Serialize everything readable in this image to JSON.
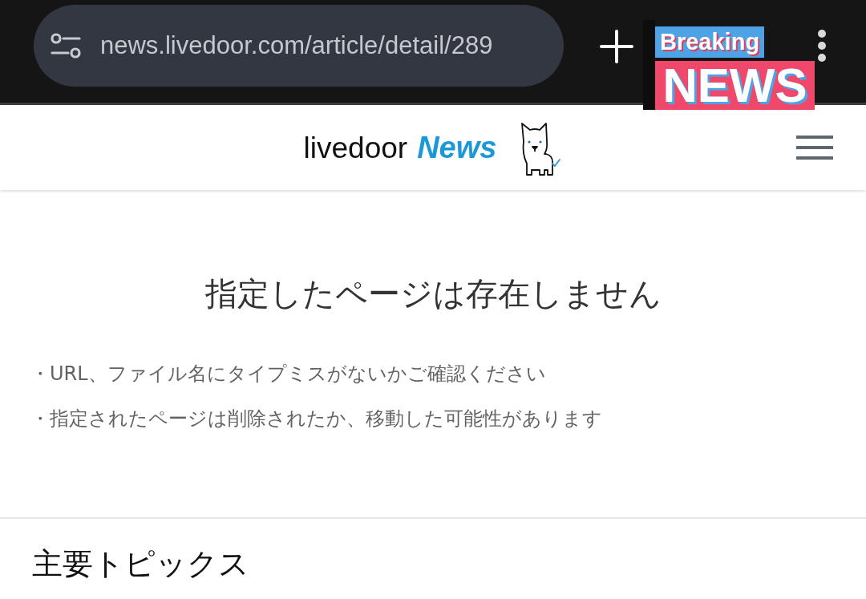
{
  "browser_bar": {
    "url": "news.livedoor.com/article/detail/289"
  },
  "sticker": {
    "top_text": "Breaking",
    "bottom_text": "NEWS"
  },
  "header": {
    "logo_word_1": "livedoor",
    "logo_word_2": "News"
  },
  "error": {
    "title": "指定したページは存在しません",
    "notes": [
      "・URL、ファイル名にタイプミスがないかご確認ください",
      "・指定されたページは削除されたか、移動した可能性があります"
    ]
  },
  "section": {
    "title": "主要トピックス"
  }
}
